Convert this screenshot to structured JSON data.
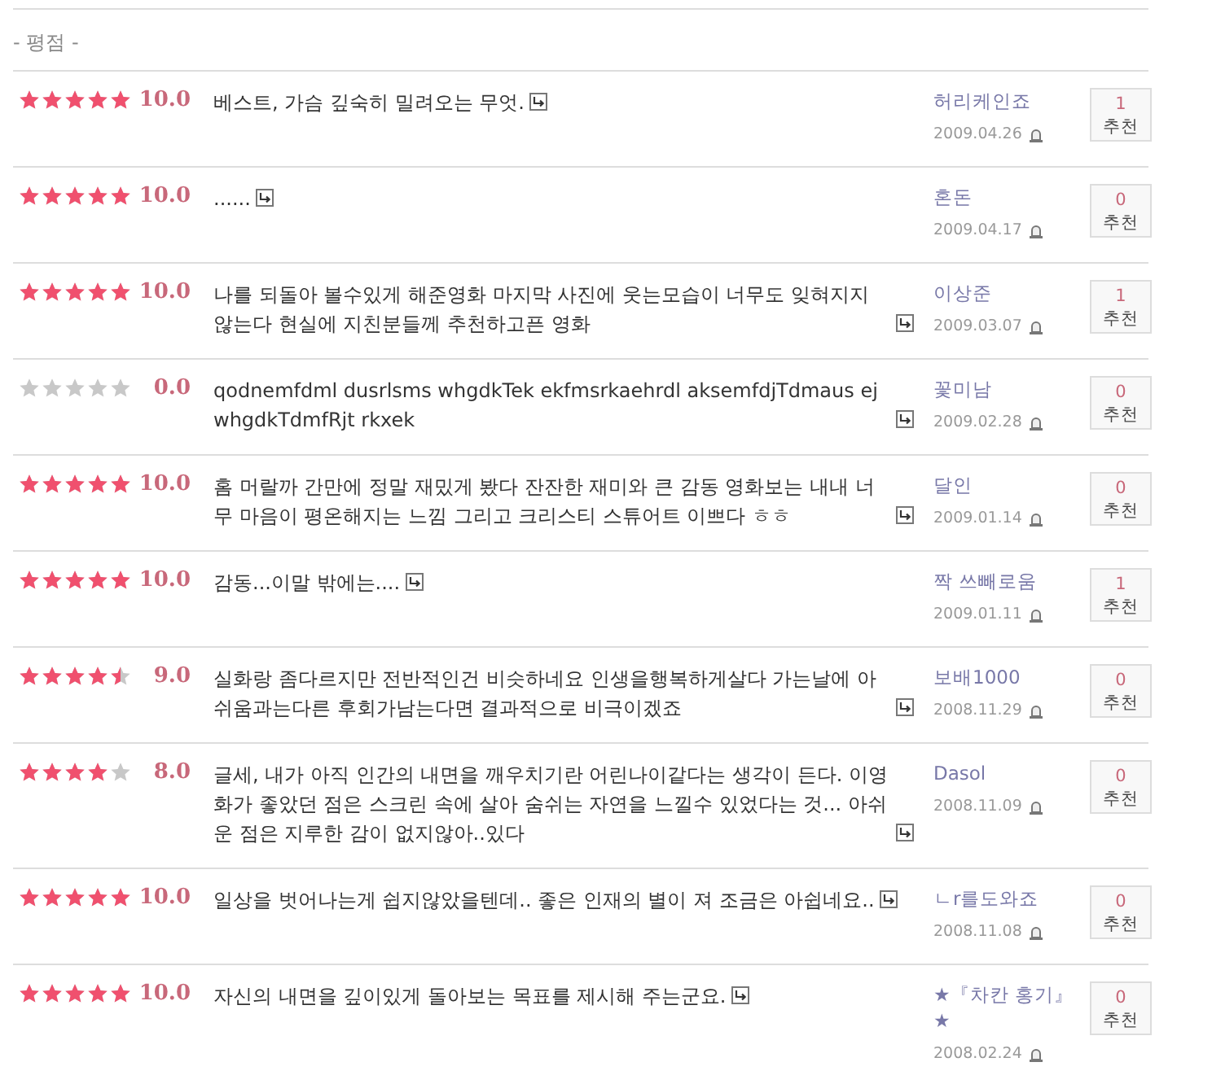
{
  "section_title": "- 평점 -",
  "reviews": [
    {
      "stars": 5,
      "score": "10.0",
      "comment": "베스트, 가슴 깊숙히 밀려오는 무엇.",
      "user": "허리케인죠",
      "date": "2009.04.26",
      "count": "1",
      "button": "추천"
    },
    {
      "stars": 5,
      "score": "10.0",
      "comment": "......",
      "user": "혼돈",
      "date": "2009.04.17",
      "count": "0",
      "button": "추천"
    },
    {
      "stars": 5,
      "score": "10.0",
      "comment": "나를 되돌아 볼수있게 해준영화 마지막 사진에 웃는모습이 너무도 잊혀지지 않는다 현실에 지친분들께 추천하고픈 영화",
      "user": "이상준",
      "date": "2009.03.07",
      "count": "1",
      "button": "추천"
    },
    {
      "stars": 0,
      "score": "0.0",
      "comment": "qodnemfdml dusrlsms whgdkTek ekfmsrkaehrdl aksemfdjTdmaus ej whgdkTdmfRjt rkxek",
      "user": "꽃미남",
      "date": "2009.02.28",
      "count": "0",
      "button": "추천"
    },
    {
      "stars": 5,
      "score": "10.0",
      "comment": "홈 머랄까 간만에 정말 재밌게 봤다 잔잔한 재미와 큰 감동 영화보는 내내 너무 마음이 평온해지는 느낌 그리고 크리스티 스튜어트 이쁘다 ㅎㅎ",
      "user": "달인",
      "date": "2009.01.14",
      "count": "0",
      "button": "추천"
    },
    {
      "stars": 5,
      "score": "10.0",
      "comment": "감동...이말 밖에는....",
      "user": "짝 쓰빼로움",
      "date": "2009.01.11",
      "count": "1",
      "button": "추천"
    },
    {
      "stars": 4.5,
      "score": "9.0",
      "comment": "실화랑 좀다르지만 전반적인건 비슷하네요 인생을행복하게살다 가는날에 아쉬움과는다른 후회가남는다면 결과적으로 비극이겠죠",
      "user": "보배1000",
      "date": "2008.11.29",
      "count": "0",
      "button": "추천"
    },
    {
      "stars": 4,
      "score": "8.0",
      "comment": "글세, 내가 아직 인간의 내면을 깨우치기란 어린나이같다는 생각이 든다. 이영화가 좋았던 점은 스크린 속에 살아 숨쉬는 자연을 느낄수 있었다는 것... 아쉬운 점은 지루한 감이 없지않아..있다",
      "user": "Dasol",
      "date": "2008.11.09",
      "count": "0",
      "button": "추천"
    },
    {
      "stars": 5,
      "score": "10.0",
      "comment": "일상을 벗어나는게 쉽지않았을텐데.. 좋은 인재의 별이 져 조금은 아쉽네요..",
      "user": "ㄴr를도와죠",
      "date": "2008.11.08",
      "count": "0",
      "button": "추천"
    },
    {
      "stars": 5,
      "score": "10.0",
      "comment": "자신의 내면을 깊이있게 돌아보는 목표를 제시해 주는군요.",
      "user": "★『차칸 홍기』★",
      "date": "2008.02.24",
      "count": "0",
      "button": "추천"
    }
  ]
}
